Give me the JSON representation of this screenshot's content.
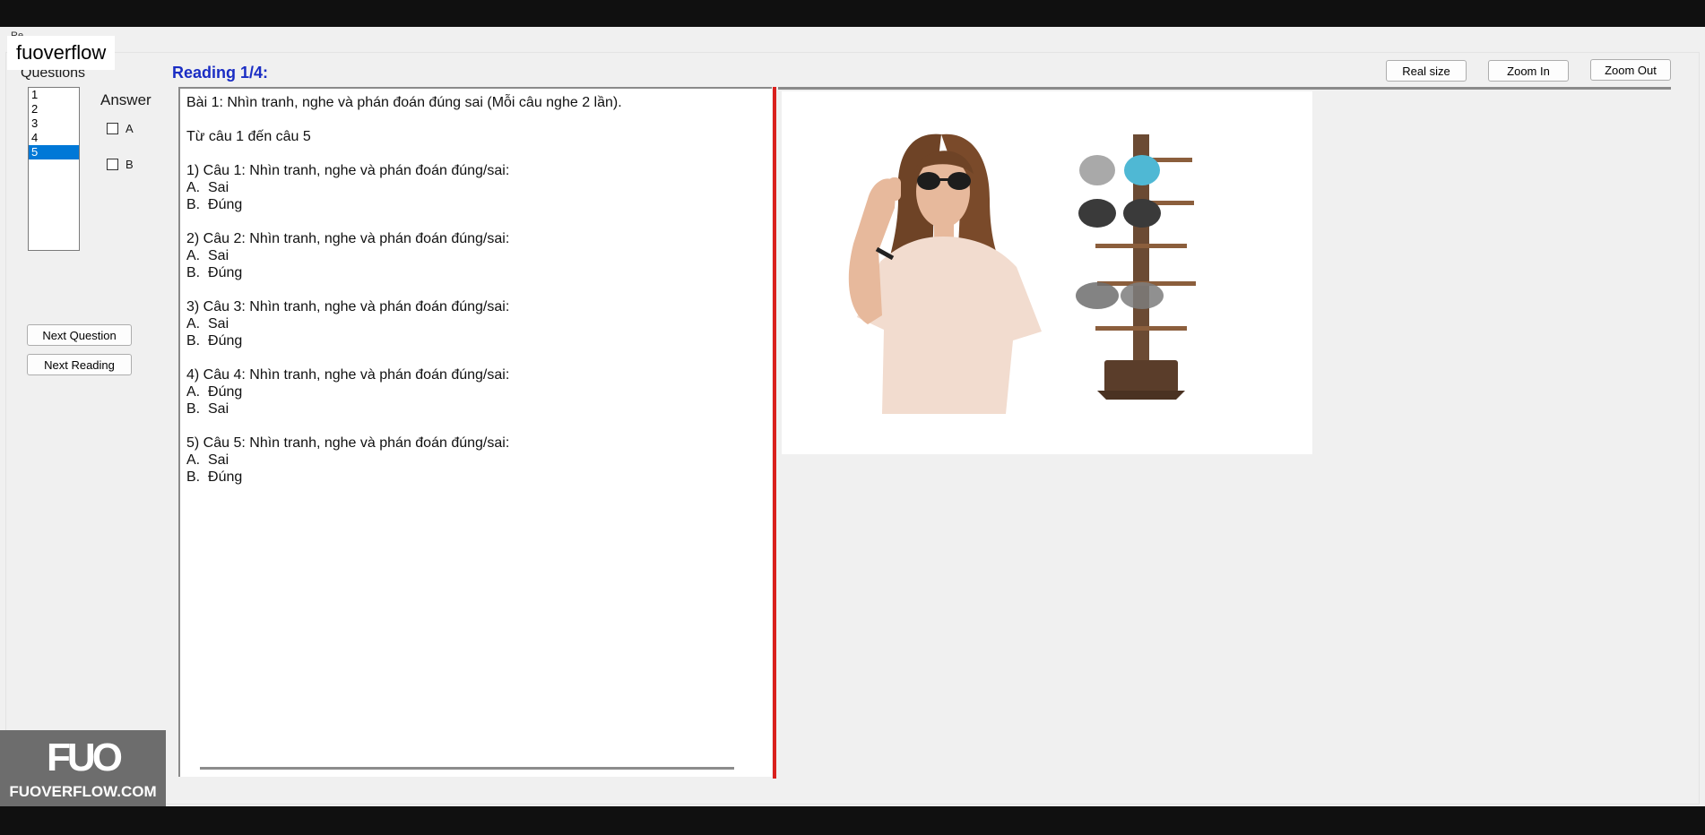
{
  "window": {
    "caption_fragment": "Re..."
  },
  "overlay": {
    "watermark_label": "fuoverflow"
  },
  "left": {
    "questions_label": "Questions",
    "answer_label": "Answer",
    "question_list": [
      "1",
      "2",
      "3",
      "4",
      "5"
    ],
    "selected_question": "5",
    "options": [
      "A",
      "B"
    ],
    "next_question_label": "Next Question",
    "next_reading_label": "Next Reading"
  },
  "reading": {
    "title": "Reading 1/4:",
    "lines": [
      "Bài 1: Nhìn tranh, nghe và phán đoán đúng sai (Mỗi câu nghe 2 lần).",
      "",
      "Từ câu 1 đến câu 5",
      "",
      "1) Câu 1: Nhìn tranh, nghe và phán đoán đúng/sai:",
      "A.  Sai",
      "B.  Đúng",
      "",
      "2) Câu 2: Nhìn tranh, nghe và phán đoán đúng/sai:",
      "A.  Sai",
      "B.  Đúng",
      "",
      "3) Câu 3: Nhìn tranh, nghe và phán đoán đúng/sai:",
      "A.  Sai",
      "B.  Đúng",
      "",
      "4) Câu 4: Nhìn tranh, nghe và phán đoán đúng/sai:",
      "A.  Đúng",
      "B.  Sai",
      "",
      "5) Câu 5: Nhìn tranh, nghe và phán đoán đúng/sai:",
      "A.  Sai",
      "B.  Đúng"
    ]
  },
  "toolbar": {
    "real_size_label": "Real size",
    "zoom_in_label": "Zoom In",
    "zoom_out_label": "Zoom Out"
  },
  "logo": {
    "mark": "FUO",
    "text": "FUOVERFLOW.COM"
  },
  "colors": {
    "accent_title": "#1a2dc4",
    "selection": "#0078d7",
    "splitter": "#d9201d"
  }
}
